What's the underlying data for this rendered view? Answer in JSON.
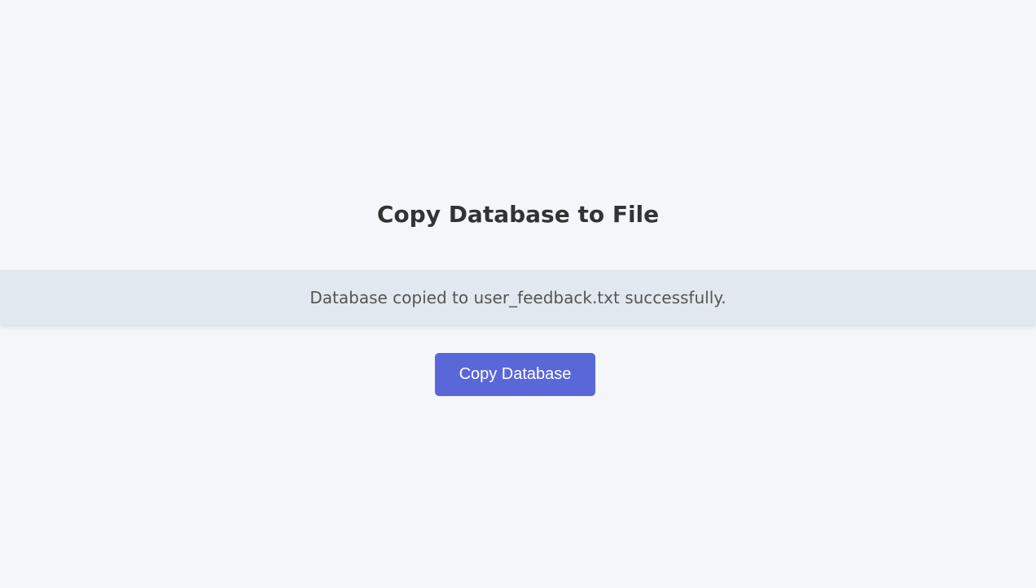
{
  "page": {
    "title": "Copy Database to File"
  },
  "status": {
    "message": "Database copied to user_feedback.txt successfully."
  },
  "actions": {
    "copy_button_label": "Copy Database"
  },
  "colors": {
    "background": "#f4f6fa",
    "banner_background": "#e1e8ef",
    "button_background": "#5a67d8",
    "button_text": "#ffffff",
    "title_text": "#333333",
    "status_text": "#555555"
  }
}
